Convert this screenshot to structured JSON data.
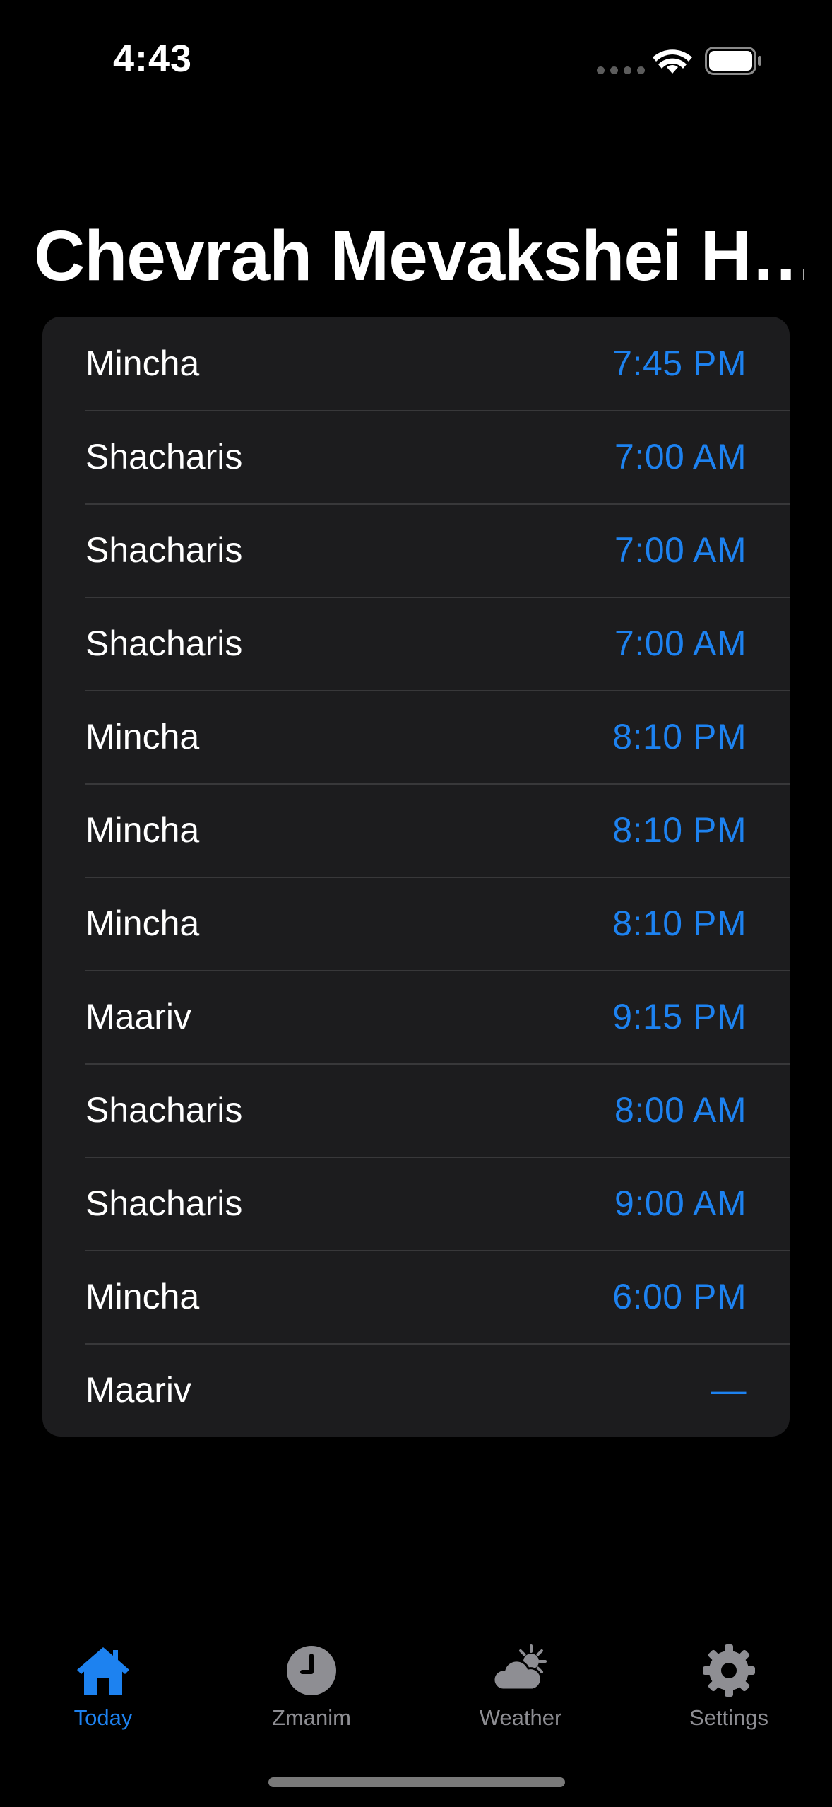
{
  "status_bar": {
    "time": "4:43"
  },
  "page": {
    "title": "Chevrah Mevakshei H…"
  },
  "schedule": [
    {
      "name": "Mincha",
      "time": "7:45 PM"
    },
    {
      "name": "Shacharis",
      "time": "7:00 AM"
    },
    {
      "name": "Shacharis",
      "time": "7:00 AM"
    },
    {
      "name": "Shacharis",
      "time": "7:00 AM"
    },
    {
      "name": "Mincha",
      "time": "8:10 PM"
    },
    {
      "name": "Mincha",
      "time": "8:10 PM"
    },
    {
      "name": "Mincha",
      "time": "8:10 PM"
    },
    {
      "name": "Maariv",
      "time": "9:15 PM"
    },
    {
      "name": "Shacharis",
      "time": "8:00 AM"
    },
    {
      "name": "Shacharis",
      "time": "9:00 AM"
    },
    {
      "name": "Mincha",
      "time": "6:00 PM"
    },
    {
      "name": "Maariv",
      "time": "—"
    }
  ],
  "tab_bar": {
    "tabs": [
      {
        "label": "Today",
        "icon": "house-icon",
        "active": true
      },
      {
        "label": "Zmanim",
        "icon": "clock-icon",
        "active": false
      },
      {
        "label": "Weather",
        "icon": "cloud-sun-icon",
        "active": false
      },
      {
        "label": "Settings",
        "icon": "gear-icon",
        "active": false
      }
    ]
  },
  "colors": {
    "accent": "#1d82f0",
    "background": "#000000",
    "card": "#1c1c1e",
    "inactive_tab": "#8e8e93"
  }
}
